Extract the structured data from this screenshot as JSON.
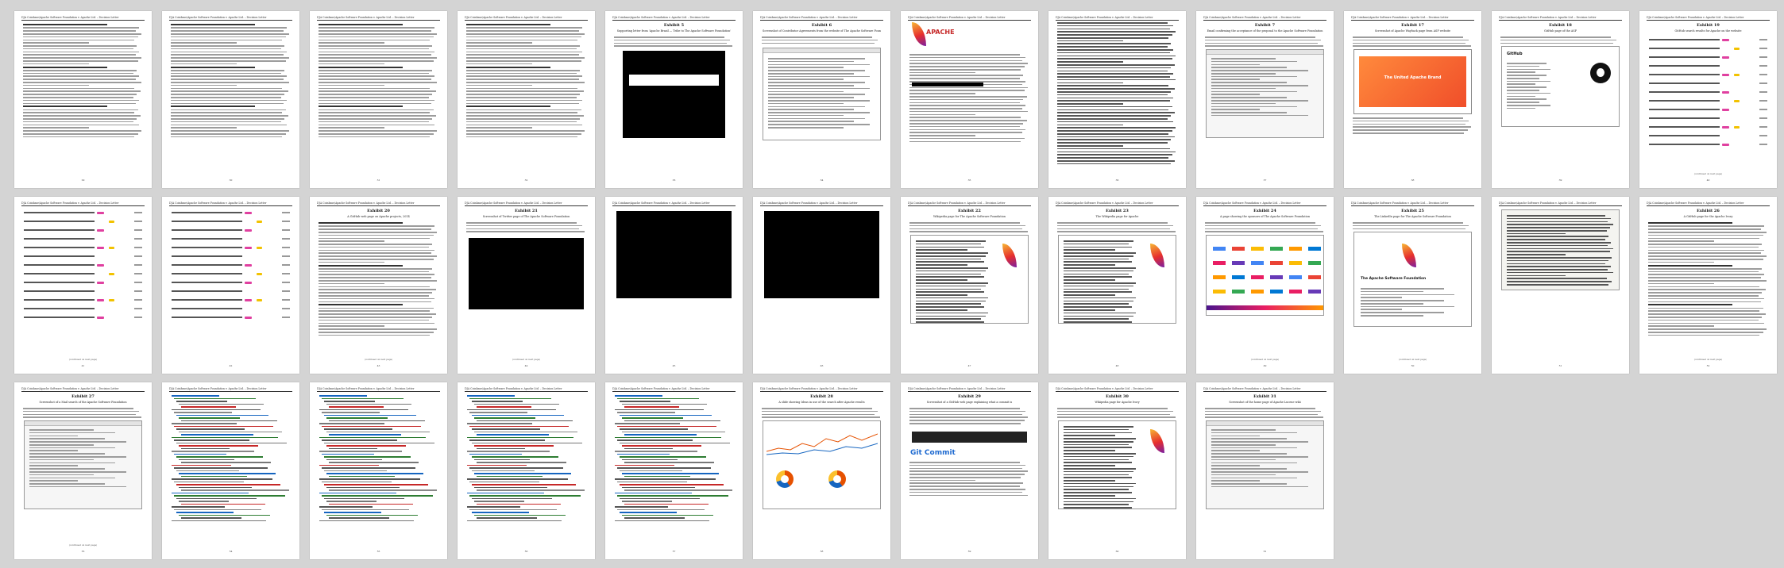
{
  "document": {
    "running_header": "DJA Coinbase/Apache Software Foundation v. Apache Ltd. – Decision Letter",
    "continued": "(continued on next page)"
  },
  "pages": [
    {
      "kind": "text",
      "title": "",
      "page_number": "29"
    },
    {
      "kind": "text",
      "title": "",
      "page_number": "30"
    },
    {
      "kind": "text",
      "title": "",
      "page_number": "31"
    },
    {
      "kind": "text",
      "title": "",
      "page_number": "32"
    },
    {
      "kind": "exhibit-black",
      "title": "Exhibit 5",
      "subtitle": "Supporting letter from 'Apache Brazil — Tribe to The Apache Software Foundation'",
      "page_number": "33"
    },
    {
      "kind": "exhibit-form",
      "title": "Exhibit 6",
      "subtitle": "Screenshot of Contributor Agreements from the website of The Apache Software Foundation",
      "page_number": "34"
    },
    {
      "kind": "apache-letter",
      "title": "",
      "logo_text": "APACHE",
      "page_number": "35"
    },
    {
      "kind": "dense-text",
      "title": "",
      "page_number": "36"
    },
    {
      "kind": "screenshot",
      "title": "Exhibit 7",
      "subtitle": "Email confirming the acceptance of the proposal to the Apache Software Foundation",
      "page_number": "37"
    },
    {
      "kind": "orange",
      "title": "Exhibit 17",
      "subtitle": "Screenshot of Apache Wayback page from ASF website",
      "banner": "The United Apache Brand",
      "page_number": "38"
    },
    {
      "kind": "github",
      "title": "Exhibit 18",
      "subtitle": "GitHub page of the ASF",
      "brand": "GitHub",
      "page_number": "39"
    },
    {
      "kind": "list",
      "title": "Exhibit 19",
      "subtitle": "GitHub search results for Apache on the website",
      "page_number": "40"
    },
    {
      "kind": "list",
      "title": "",
      "page_number": "41"
    },
    {
      "kind": "list",
      "title": "",
      "page_number": "42"
    },
    {
      "kind": "text",
      "title": "Exhibit 20",
      "subtitle": "A GitHub web page on Apache projects, 2014",
      "page_number": "43"
    },
    {
      "kind": "black-large",
      "title": "Exhibit 21",
      "subtitle": "Screenshot of Twitter page of The Apache Software Foundation",
      "page_number": "44"
    },
    {
      "kind": "black-box",
      "title": "",
      "page_number": "45"
    },
    {
      "kind": "black-box",
      "title": "",
      "page_number": "46"
    },
    {
      "kind": "wiki",
      "title": "Exhibit 22",
      "subtitle": "Wikipedia page for The Apache Software Foundation",
      "page_number": "47"
    },
    {
      "kind": "wiki",
      "title": "Exhibit 23",
      "subtitle": "The Wikipedia page for Apache",
      "page_number": "48"
    },
    {
      "kind": "logos",
      "title": "Exhibit 24",
      "subtitle": "A page showing the sponsors of The Apache Software Foundation",
      "page_number": "49"
    },
    {
      "kind": "apache-card",
      "title": "Exhibit 25",
      "subtitle": "The LinkedIn page for The Apache Software Foundation",
      "card_title": "The Apache Software Foundation",
      "page_number": "50"
    },
    {
      "kind": "text-box",
      "title": "",
      "page_number": "51"
    },
    {
      "kind": "text",
      "title": "Exhibit 26",
      "subtitle": "A GitHub page for the Apache Ivory",
      "page_number": "52"
    },
    {
      "kind": "screenshot",
      "title": "Exhibit 27",
      "subtitle": "Screenshot of a Mail search of the Apache Software Foundation",
      "page_number": "53"
    },
    {
      "kind": "code",
      "title": "",
      "page_number": "54"
    },
    {
      "kind": "code",
      "title": "",
      "page_number": "55"
    },
    {
      "kind": "code",
      "title": "",
      "page_number": "56"
    },
    {
      "kind": "code",
      "title": "",
      "page_number": "57"
    },
    {
      "kind": "charts",
      "title": "Exhibit 28",
      "subtitle": "A slide showing Ideas in use of the search after Apache results",
      "page_number": "58"
    },
    {
      "kind": "git",
      "title": "Exhibit 29",
      "subtitle": "Screenshot of a GitHub web page explaining what a commit is",
      "brand": "Git Commit",
      "page_number": "59"
    },
    {
      "kind": "wiki",
      "title": "Exhibit 30",
      "subtitle": "Wikipedia page for Apache Ivory",
      "page_number": "60"
    },
    {
      "kind": "screenshot",
      "title": "Exhibit 31",
      "subtitle": "Screenshot of the home page of Apache Lucene wiki",
      "page_number": "61"
    }
  ],
  "colors": {
    "background": "#d4d4d4",
    "apache_red": "#c62828",
    "apache_orange": "#f04e2a",
    "link_blue": "#1e6ad0",
    "highlight_pink": "#e040a0",
    "highlight_yellow": "#f2c200"
  }
}
